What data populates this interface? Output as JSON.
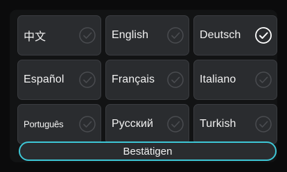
{
  "languages": [
    {
      "label": "中文",
      "selected": false
    },
    {
      "label": "English",
      "selected": false
    },
    {
      "label": "Deutsch",
      "selected": true
    },
    {
      "label": "Español",
      "selected": false
    },
    {
      "label": "Français",
      "selected": false
    },
    {
      "label": "Italiano",
      "selected": false
    },
    {
      "label": "Português",
      "selected": false
    },
    {
      "label": "Русский",
      "selected": false
    },
    {
      "label": "Turkish",
      "selected": false
    }
  ],
  "confirm_label": "Bestätigen",
  "colors": {
    "background": "#0b0b0c",
    "tile": "#2a2c2f",
    "accent": "#3ec7d6",
    "check_inactive": "#4a4c50",
    "check_active": "#ffffff"
  },
  "icons": {
    "checkmark": "check-circle-icon"
  }
}
